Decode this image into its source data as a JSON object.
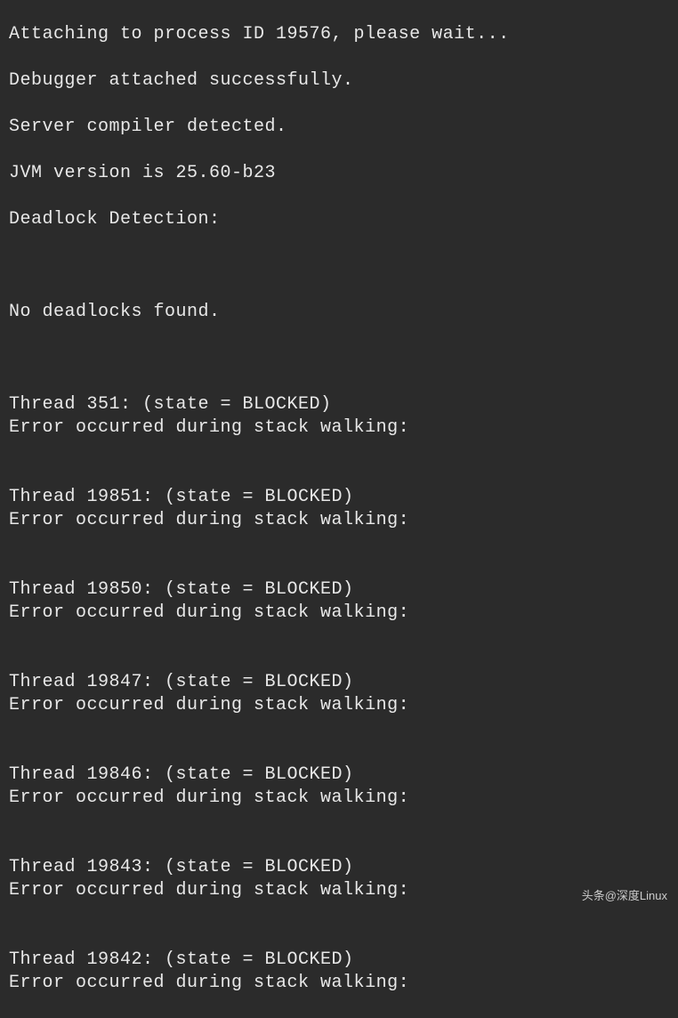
{
  "terminal": {
    "header": {
      "line1": "Attaching to process ID 19576, please wait...",
      "line2": "Debugger attached successfully.",
      "line3": "Server compiler detected.",
      "line4": "JVM version is 25.60-b23",
      "line5": "Deadlock Detection:"
    },
    "deadlock_status": "No deadlocks found.",
    "threads": [
      {
        "id": "351",
        "state": "BLOCKED",
        "error": "Error occurred during stack walking:"
      },
      {
        "id": "19851",
        "state": "BLOCKED",
        "error": "Error occurred during stack walking:"
      },
      {
        "id": "19850",
        "state": "BLOCKED",
        "error": "Error occurred during stack walking:"
      },
      {
        "id": "19847",
        "state": "BLOCKED",
        "error": "Error occurred during stack walking:"
      },
      {
        "id": "19846",
        "state": "BLOCKED",
        "error": "Error occurred during stack walking:"
      },
      {
        "id": "19843",
        "state": "BLOCKED",
        "error": "Error occurred during stack walking:"
      },
      {
        "id": "19842",
        "state": "BLOCKED",
        "error": "Error occurred during stack walking:"
      }
    ],
    "thread_prefix": "Thread ",
    "state_prefix": ": (state = ",
    "state_suffix": ")"
  },
  "watermark": {
    "prefix": "头条",
    "text": "@深度Linux"
  }
}
